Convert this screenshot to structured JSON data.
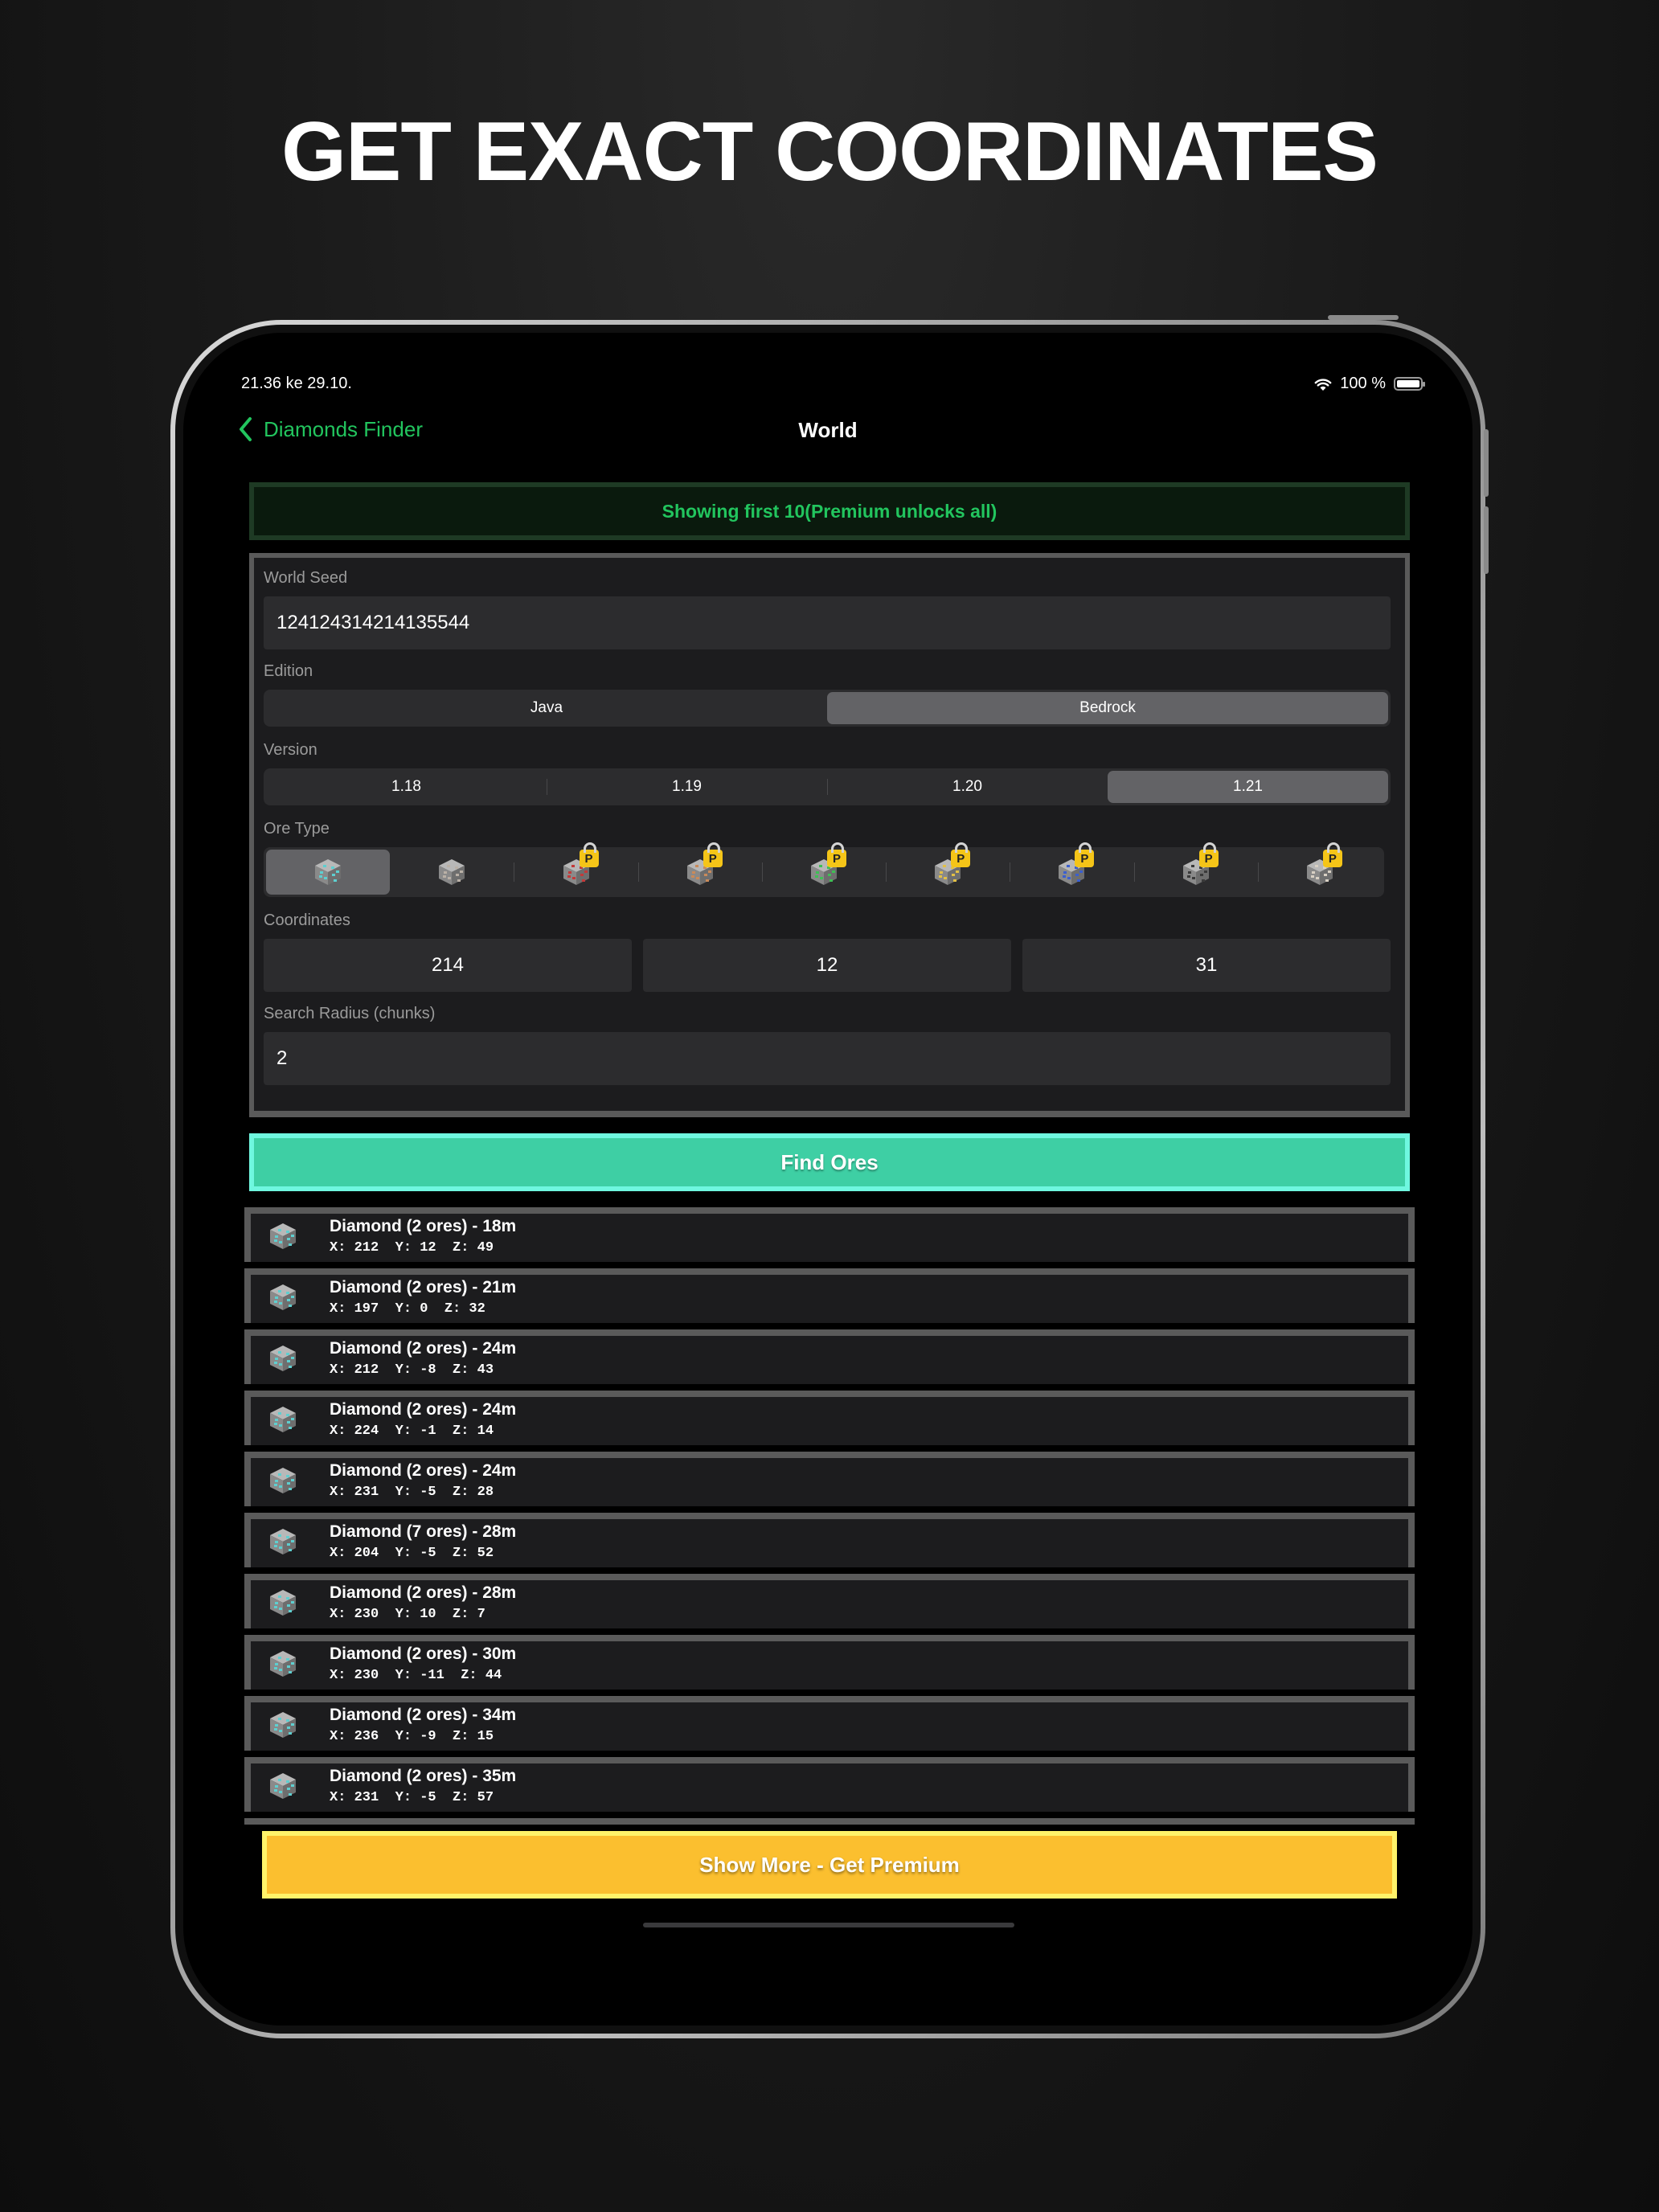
{
  "headline": "GET EXACT COORDINATES",
  "status_bar": {
    "time": "21.36   ke 29.10.",
    "battery": "100 %",
    "wifi_icon": "wifi-icon",
    "battery_icon": "battery-icon"
  },
  "nav": {
    "back_label": "Diamonds Finder",
    "title": "World",
    "back_icon": "chevron-left-icon"
  },
  "banner": "Showing first 10(Premium unlocks all)",
  "form": {
    "seed_label": "World Seed",
    "seed_value": "124124314214135544",
    "edition_label": "Edition",
    "editions": [
      "Java",
      "Bedrock"
    ],
    "edition_selected": "Bedrock",
    "version_label": "Version",
    "versions": [
      "1.18",
      "1.19",
      "1.20",
      "1.21"
    ],
    "version_selected": "1.21",
    "ore_label": "Ore Type",
    "ores": [
      {
        "icon": "diamond-ore-icon",
        "locked": false,
        "selected": true,
        "color": "#5ecfd0"
      },
      {
        "icon": "iron-ore-icon",
        "locked": false,
        "selected": false,
        "color": "#b9b0a6"
      },
      {
        "icon": "redstone-ore-icon",
        "locked": true,
        "selected": false,
        "color": "#c23a3a"
      },
      {
        "icon": "copper-ore-icon",
        "locked": true,
        "selected": false,
        "color": "#c98a5a"
      },
      {
        "icon": "emerald-ore-icon",
        "locked": true,
        "selected": false,
        "color": "#3fbf55"
      },
      {
        "icon": "gold-ore-icon",
        "locked": true,
        "selected": false,
        "color": "#e2c046"
      },
      {
        "icon": "lapis-ore-icon",
        "locked": true,
        "selected": false,
        "color": "#3b5fcf"
      },
      {
        "icon": "coal-ore-icon",
        "locked": true,
        "selected": false,
        "color": "#3a3a3a"
      },
      {
        "icon": "quartz-ore-icon",
        "locked": true,
        "selected": false,
        "color": "#d8d0c4"
      }
    ],
    "lock_badge": "P",
    "coords_label": "Coordinates",
    "coords": [
      "214",
      "12",
      "31"
    ],
    "radius_label": "Search Radius (chunks)",
    "radius_value": "2"
  },
  "find_button": "Find Ores",
  "results": [
    {
      "title": "Diamond (2 ores) - 18m",
      "coords": "X: 212  Y: 12  Z: 49"
    },
    {
      "title": "Diamond (2 ores) - 21m",
      "coords": "X: 197  Y: 0  Z: 32"
    },
    {
      "title": "Diamond (2 ores) - 24m",
      "coords": "X: 212  Y: -8  Z: 43"
    },
    {
      "title": "Diamond (2 ores) - 24m",
      "coords": "X: 224  Y: -1  Z: 14"
    },
    {
      "title": "Diamond (2 ores) - 24m",
      "coords": "X: 231  Y: -5  Z: 28"
    },
    {
      "title": "Diamond (7 ores) - 28m",
      "coords": "X: 204  Y: -5  Z: 52"
    },
    {
      "title": "Diamond (2 ores) - 28m",
      "coords": "X: 230  Y: 10  Z: 7"
    },
    {
      "title": "Diamond (2 ores) - 30m",
      "coords": "X: 230  Y: -11  Z: 44"
    },
    {
      "title": "Diamond (2 ores) - 34m",
      "coords": "X: 236  Y: -9  Z: 15"
    },
    {
      "title": "Diamond (2 ores) - 35m",
      "coords": "X: 231  Y: -5  Z: 57"
    }
  ],
  "premium_button": "Show More - Get Premium",
  "colors": {
    "accent_green": "#22c55e",
    "find_button": "#3ecfa4",
    "premium_button": "#fbbf2f"
  }
}
